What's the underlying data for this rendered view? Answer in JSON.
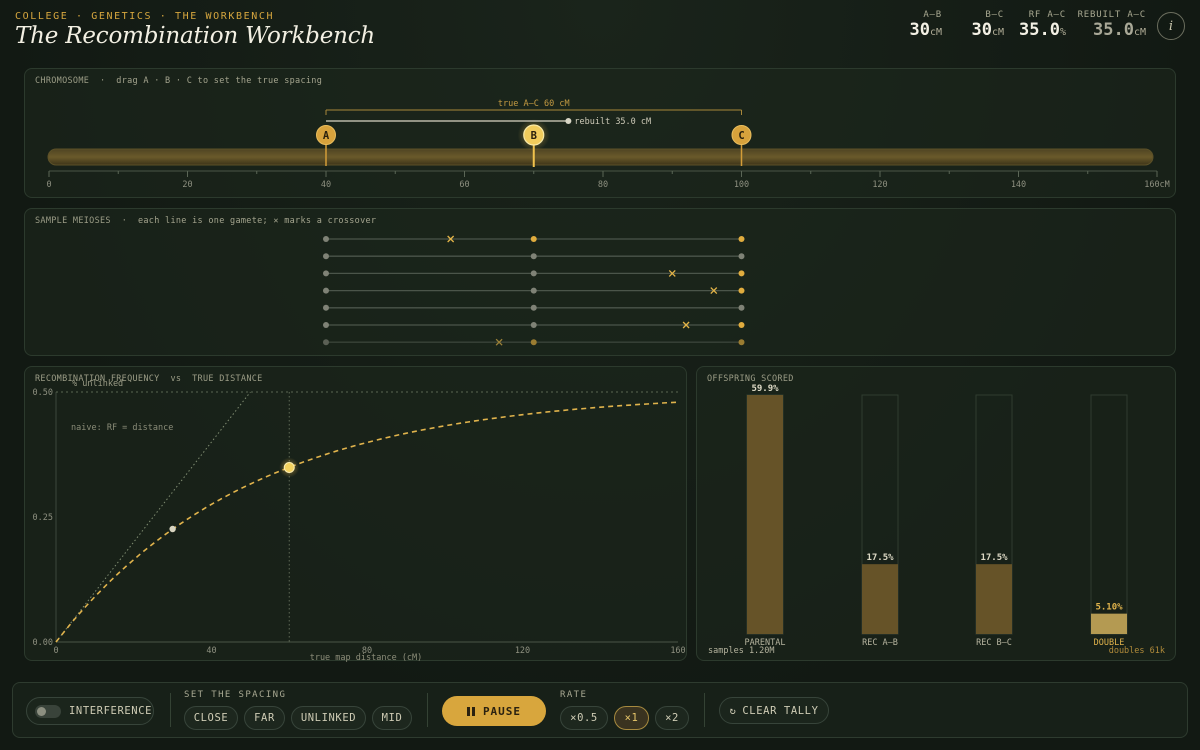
{
  "header": {
    "crumbs": "COLLEGE · GENETICS · THE WORKBENCH",
    "title": "The Recombination Workbench",
    "stats": [
      {
        "label": "A–B",
        "value": "30",
        "unit": "cM"
      },
      {
        "label": "B–C",
        "value": "30",
        "unit": "cM"
      },
      {
        "label": "RF A–C",
        "value": "35.0",
        "unit": "%"
      },
      {
        "label": "REBUILT A–C",
        "value": "35.0",
        "unit": "cM"
      }
    ],
    "info_icon": "i"
  },
  "chromosome": {
    "title": "CHROMOSOME",
    "hint": "drag A · B · C to set the true spacing",
    "true_label": "true A–C 60 cM",
    "rebuilt_label": "rebuilt 35.0 cM",
    "loci": [
      {
        "name": "A",
        "position_cm": 40
      },
      {
        "name": "B",
        "position_cm": 70
      },
      {
        "name": "C",
        "position_cm": 100
      }
    ],
    "rebuilt_cm": 35.0,
    "axis_max_cm": 160,
    "tick_labels": [
      "0",
      "20",
      "40",
      "60",
      "80",
      "100",
      "120",
      "140",
      "160cM"
    ]
  },
  "meioses": {
    "title": "SAMPLE MEIOSES",
    "hint": "each line is one gamete; ✕ marks a crossover",
    "rows": [
      {
        "crossover_cm": 58,
        "b_gold": true,
        "c_gold": true
      },
      {
        "crossover_cm": null,
        "b_gold": false,
        "c_gold": false
      },
      {
        "crossover_cm": 90,
        "b_gold": false,
        "c_gold": true
      },
      {
        "crossover_cm": 96,
        "b_gold": false,
        "c_gold": true
      },
      {
        "crossover_cm": null,
        "b_gold": false,
        "c_gold": false
      },
      {
        "crossover_cm": 92,
        "b_gold": false,
        "c_gold": true
      },
      {
        "crossover_cm": 65,
        "b_gold": true,
        "c_gold": true
      }
    ]
  },
  "rf_panel": {
    "title": "RECOMBINATION FREQUENCY",
    "vs": "vs",
    "title2": "TRUE DISTANCE",
    "naive_label": "naive: RF = distance"
  },
  "offspring": {
    "title": "OFFSPRING SCORED",
    "samples": "samples 1.20M",
    "doubles": "doubles 61k"
  },
  "chart_data": [
    {
      "type": "line",
      "title": "RECOMBINATION FREQUENCY vs TRUE DISTANCE",
      "xlabel": "true map distance (cM)",
      "ylabel": "% unlinked",
      "xlim": [
        0,
        160
      ],
      "ylim": [
        0,
        0.5
      ],
      "x_ticks": [
        "0",
        "40",
        "80",
        "120",
        "160"
      ],
      "y_ticks": [
        "0.00",
        "0.25",
        "0.50"
      ],
      "series": [
        {
          "model": "haldane",
          "x": [
            0,
            10,
            20,
            30,
            40,
            50,
            60,
            70,
            80,
            90,
            100,
            110,
            120,
            130,
            140,
            150,
            160
          ],
          "y": [
            0,
            0.091,
            0.165,
            0.226,
            0.275,
            0.316,
            0.349,
            0.377,
            0.399,
            0.417,
            0.432,
            0.445,
            0.455,
            0.463,
            0.47,
            0.475,
            0.48
          ]
        },
        {
          "model": "naive",
          "x": [
            0,
            50
          ],
          "y": [
            0,
            0.5
          ]
        }
      ],
      "points": [
        {
          "x": 30,
          "y": 0.226
        },
        {
          "x": 60,
          "y": 0.349
        }
      ],
      "grid": false
    },
    {
      "type": "bar",
      "title": "OFFSPRING SCORED",
      "categories": [
        "PARENTAL",
        "REC A–B",
        "REC B–C",
        "DOUBLE"
      ],
      "values": [
        59.9,
        17.5,
        17.5,
        5.1
      ],
      "value_labels": [
        "59.9%",
        "17.5%",
        "17.5%",
        "5.10%"
      ],
      "ylim": [
        0,
        59.9
      ]
    }
  ],
  "controls": {
    "interference_label": "INTERFERENCE",
    "spacing_label": "SET THE SPACING",
    "spacing_options": [
      "CLOSE",
      "FAR",
      "UNLINKED",
      "MID"
    ],
    "pause_label": "PAUSE",
    "rate_label": "RATE",
    "rates": [
      "×0.5",
      "×1",
      "×2"
    ],
    "active_rate": "×1",
    "clear_label": "CLEAR TALLY",
    "clear_icon": "↻"
  },
  "colors": {
    "accent": "#d8a63d",
    "accent_bright": "#f2d36a",
    "bar_fill": "#665328",
    "bar_fill_double": "#b49a52",
    "background": "#141c15"
  }
}
